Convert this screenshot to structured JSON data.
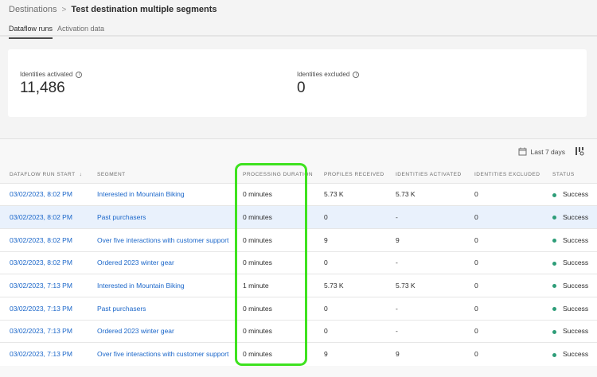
{
  "breadcrumb": {
    "parent": "Destinations",
    "separator": ">",
    "current": "Test destination multiple segments"
  },
  "tabs": [
    {
      "label": "Dataflow runs",
      "active": true
    },
    {
      "label": "Activation data",
      "active": false
    }
  ],
  "summary": {
    "identities_activated": {
      "label": "Identities activated",
      "value": "11,486"
    },
    "identities_excluded": {
      "label": "Identities excluded",
      "value": "0"
    }
  },
  "toolbar": {
    "date_filter": "Last 7 days",
    "calendar_icon": "calendar-icon",
    "column_settings_icon": "column-settings-icon"
  },
  "table": {
    "columns": [
      "DATAFLOW RUN START",
      "SEGMENT",
      "PROCESSING DURATION",
      "PROFILES RECEIVED",
      "IDENTITIES ACTIVATED",
      "IDENTITIES EXCLUDED",
      "STATUS"
    ],
    "sort_indicator": "↓",
    "status_color": "#2d9d78",
    "highlight_color": "#3ee21f",
    "rows": [
      [
        "03/02/2023, 8:02 PM",
        "Interested in Mountain Biking",
        "0 minutes",
        "5.73 K",
        "5.73 K",
        "0",
        "Success"
      ],
      [
        "03/02/2023, 8:02 PM",
        "Past purchasers",
        "0 minutes",
        "0",
        "-",
        "0",
        "Success"
      ],
      [
        "03/02/2023, 8:02 PM",
        "Over five interactions with customer support",
        "0 minutes",
        "9",
        "9",
        "0",
        "Success"
      ],
      [
        "03/02/2023, 8:02 PM",
        "Ordered 2023 winter gear",
        "0 minutes",
        "0",
        "-",
        "0",
        "Success"
      ],
      [
        "03/02/2023, 7:13 PM",
        "Interested in Mountain Biking",
        "1 minute",
        "5.73 K",
        "5.73 K",
        "0",
        "Success"
      ],
      [
        "03/02/2023, 7:13 PM",
        "Past purchasers",
        "0 minutes",
        "0",
        "-",
        "0",
        "Success"
      ],
      [
        "03/02/2023, 7:13 PM",
        "Ordered 2023 winter gear",
        "0 minutes",
        "0",
        "-",
        "0",
        "Success"
      ],
      [
        "03/02/2023, 7:13 PM",
        "Over five interactions with customer support",
        "0 minutes",
        "9",
        "9",
        "0",
        "Success"
      ]
    ],
    "selected_row": 1
  }
}
